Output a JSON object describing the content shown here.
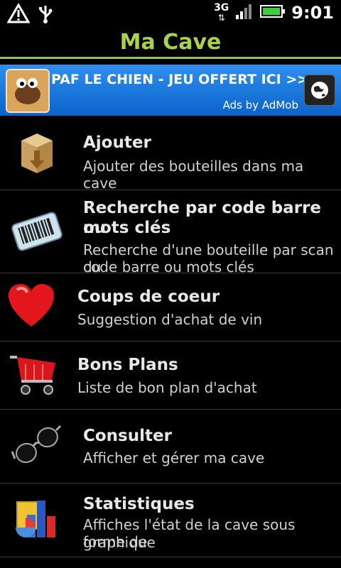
{
  "status_bar": {
    "time": "9:01",
    "network_label": "3G",
    "icons": [
      "warning-icon",
      "usb-icon",
      "network-3g-icon",
      "signal-icon",
      "battery-icon"
    ]
  },
  "app": {
    "title": "Ma Cave"
  },
  "ad": {
    "text": "PAF LE CHIEN - JEU OFFERT ICI >>",
    "provider": "Ads by AdMob",
    "icons": [
      "ad-thumbnail-icon",
      "globe-icon"
    ]
  },
  "menu": {
    "items": [
      {
        "title": "Ajouter",
        "description": "Ajouter des bouteilles dans ma cave",
        "icon": "box-download-icon"
      },
      {
        "title_line1": "Recherche par code barre ou",
        "title_line2": "mots clés",
        "description_line1": "Recherche d'une bouteille par scan du",
        "description_line2": "code barre ou mots clés",
        "icon": "barcode-icon"
      },
      {
        "title": "Coups de coeur",
        "description": "Suggestion d'achat de vin",
        "icon": "heart-icon"
      },
      {
        "title": "Bons Plans",
        "description": "Liste de bon plan d'achat",
        "icon": "shopping-cart-icon"
      },
      {
        "title": "Consulter",
        "description": "Afficher et gérer ma cave",
        "icon": "glasses-icon"
      },
      {
        "title": "Statistiques",
        "description_line1": "Affiches l'état de la cave sous forme de",
        "description_line2": "graphique",
        "icon": "chart-icon"
      }
    ]
  }
}
